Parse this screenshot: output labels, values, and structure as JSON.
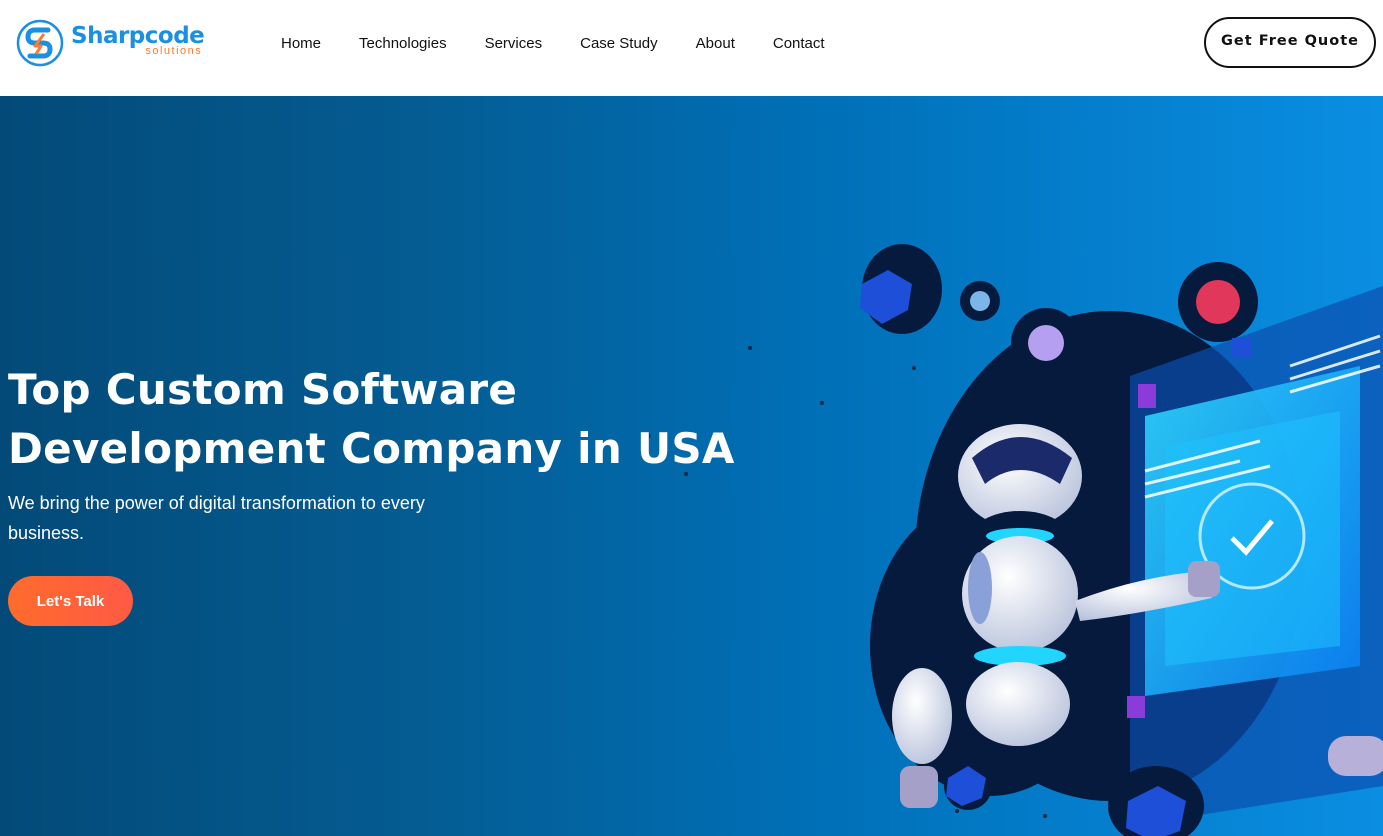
{
  "header": {
    "logo": {
      "name": "Sharpcode",
      "sub": "solutions"
    },
    "nav": [
      "Home",
      "Technologies",
      "Services",
      "Case Study",
      "About",
      "Contact"
    ],
    "cta_label": "Get Free Quote"
  },
  "hero": {
    "title": "Top Custom Software Development Company in USA",
    "subtitle": "We bring the power of digital transformation to every business.",
    "button_label": "Let's Talk"
  },
  "colors": {
    "brand_blue": "#1b8fe0",
    "brand_orange": "#ff7a2a",
    "cta_orange": "#ff6b2c",
    "hero_dark": "#034a78",
    "hero_light": "#0a8ee2"
  },
  "icons": [
    "sharpcode-logo-icon",
    "robot-illustration"
  ]
}
